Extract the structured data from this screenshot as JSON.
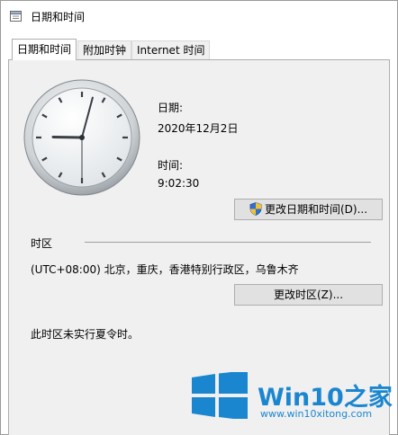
{
  "window": {
    "title": "日期和时间",
    "icon": "calendar-clock-icon"
  },
  "tabs": [
    {
      "label": "日期和时间",
      "active": true
    },
    {
      "label": "附加时钟",
      "active": false
    },
    {
      "label": "Internet 时间",
      "active": false
    }
  ],
  "date": {
    "label": "日期:",
    "value": "2020年12月2日"
  },
  "time": {
    "label": "时间:",
    "value": "9:02:30"
  },
  "clock": {
    "hour": 9,
    "minute": 2,
    "second": 30
  },
  "change_datetime_button": {
    "label": "更改日期和时间(D)...",
    "icon": "uac-shield-icon"
  },
  "timezone": {
    "section_label": "时区",
    "value": "(UTC+08:00) 北京，重庆，香港特别行政区，乌鲁木齐",
    "change_button": "更改时区(Z)...",
    "dst_note": "此时区未实行夏令时。"
  },
  "watermark": {
    "brand": "Win10",
    "brand_suffix": "之家",
    "url": "www.win10xitong.com",
    "color": "#1a86d0"
  }
}
